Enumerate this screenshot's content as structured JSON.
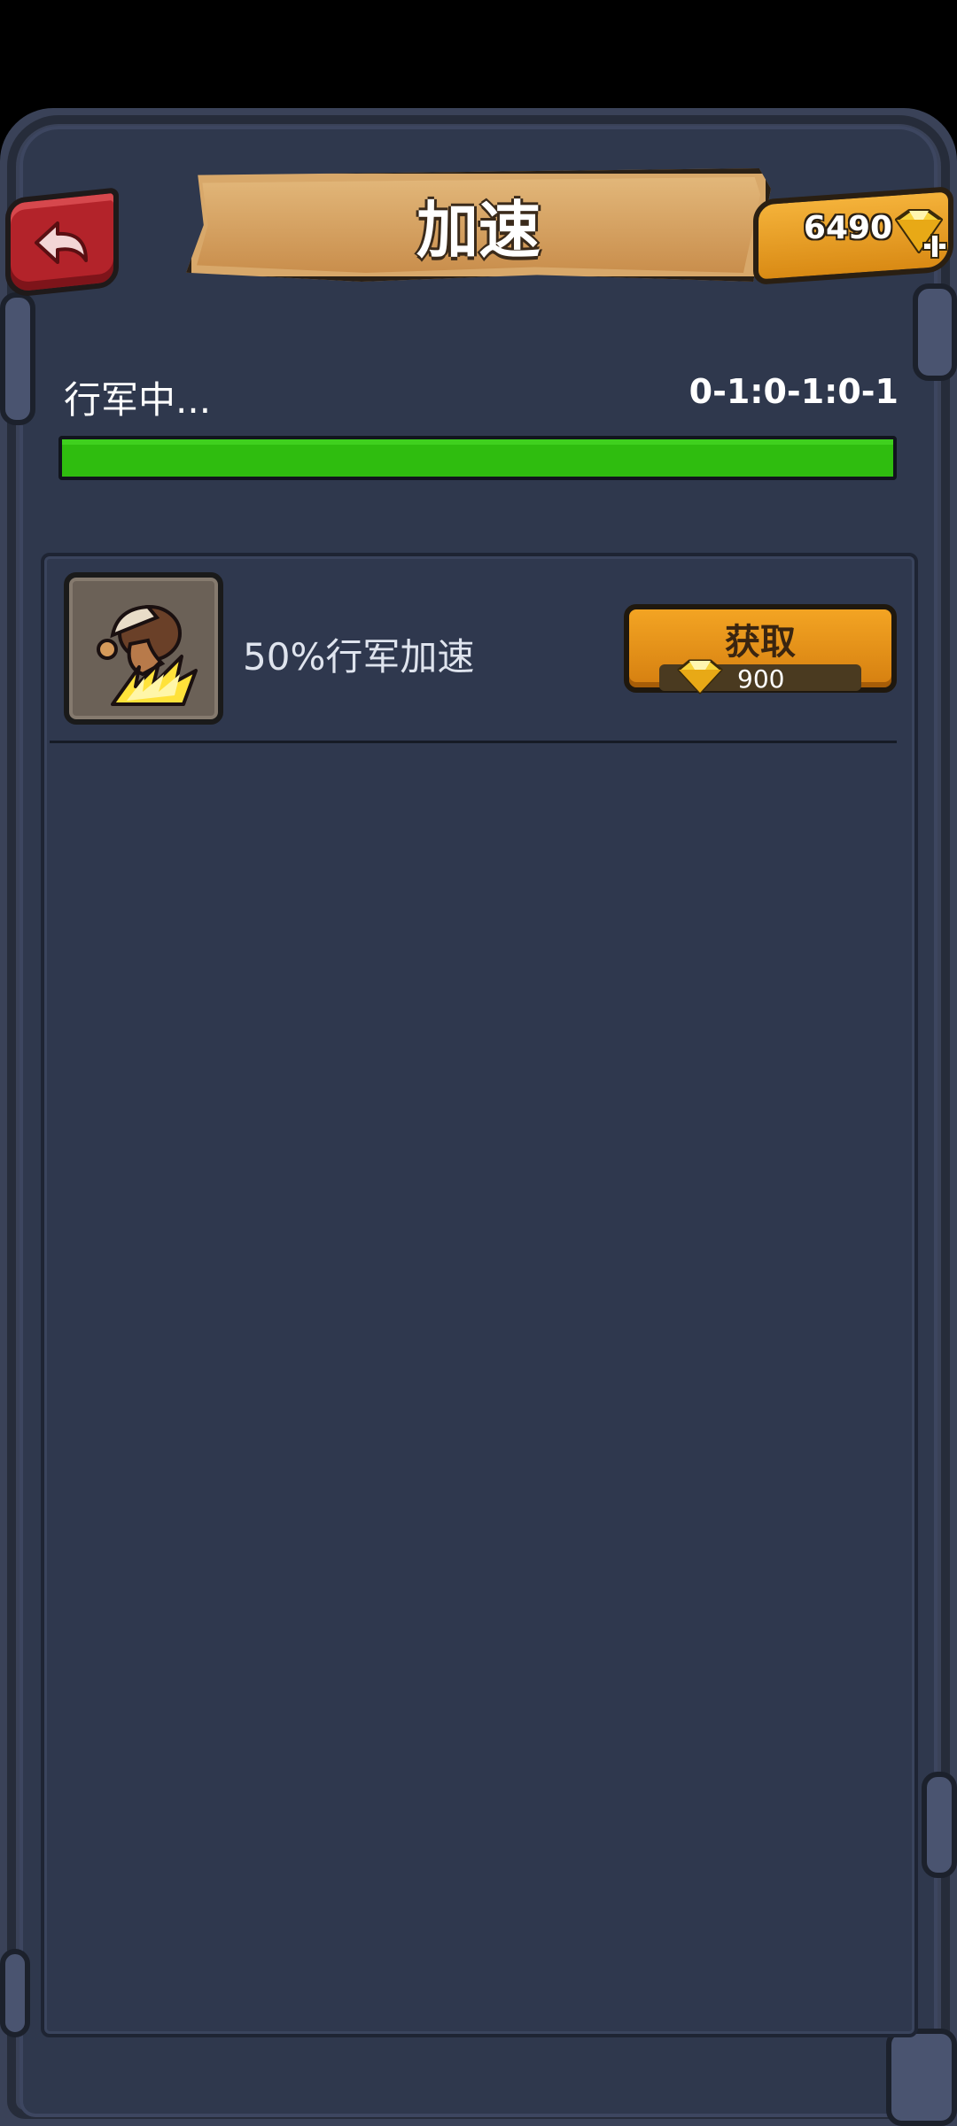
{
  "header": {
    "title": "加速",
    "gem_count": "6490"
  },
  "march": {
    "status_label": "行军中...",
    "timer": "0-1:0-1:0-1",
    "progress_fraction": 1.0
  },
  "items": [
    {
      "label": "50%行军加速",
      "button_label": "获取",
      "price": "900"
    }
  ],
  "icons": {
    "back": "back-arrow-icon",
    "gem": "diamond-icon",
    "add": "plus-icon",
    "item": "march-speedup-icon"
  },
  "colors": {
    "progress": "#2fbd0f",
    "button": "#f3a423",
    "back_button": "#b3232a"
  }
}
